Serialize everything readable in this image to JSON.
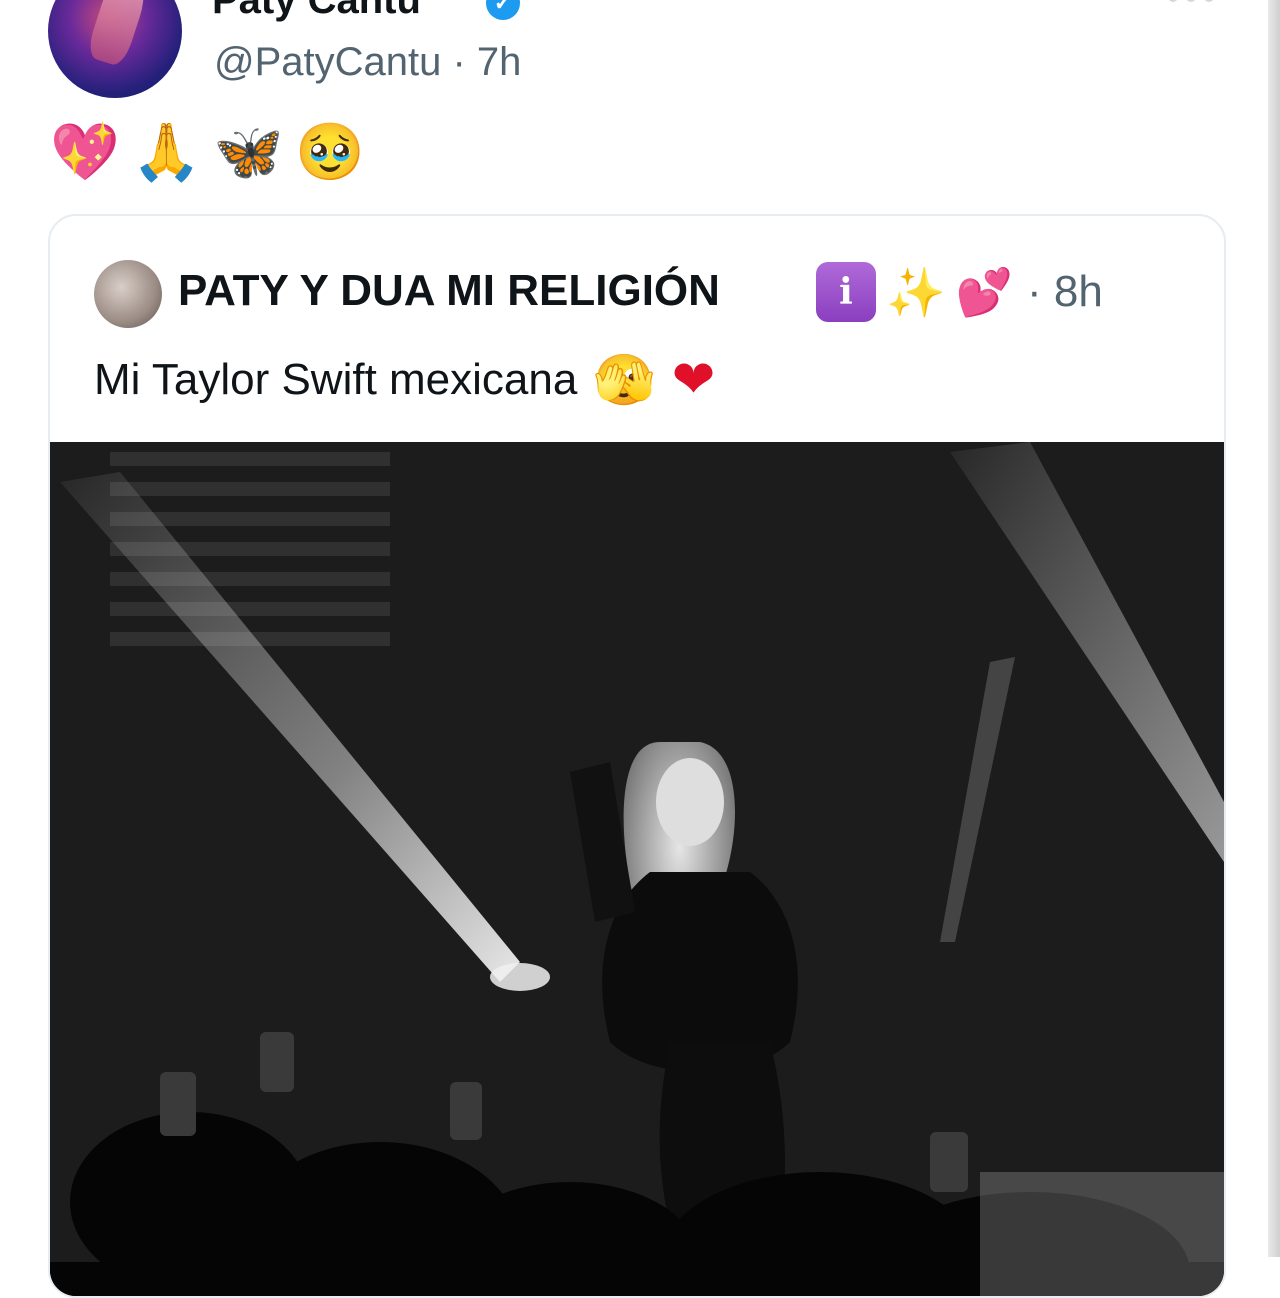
{
  "tweet": {
    "display_name": "Paty Cantu",
    "verified_glyph": "✓",
    "handle_time": "@PatyCantu · 7h",
    "emojis": [
      "💖",
      "🙏",
      "🦋",
      "🥹"
    ]
  },
  "quoted_tweet": {
    "display_name": "PATY Y DUA MI RELIGIÓN",
    "badges": {
      "info": "i",
      "sparkles": "✨",
      "hearts": "💕"
    },
    "time": "· 8h",
    "text": "Mi Taylor Swift mexicana",
    "text_emojis": [
      "🫣",
      "❤"
    ]
  },
  "icons": {
    "verified": "verified-badge-icon",
    "more": "more-options-icon"
  },
  "colors": {
    "verified_blue": "#1d9bf0",
    "secondary_text": "#536471",
    "card_border": "#e6ecf0"
  }
}
